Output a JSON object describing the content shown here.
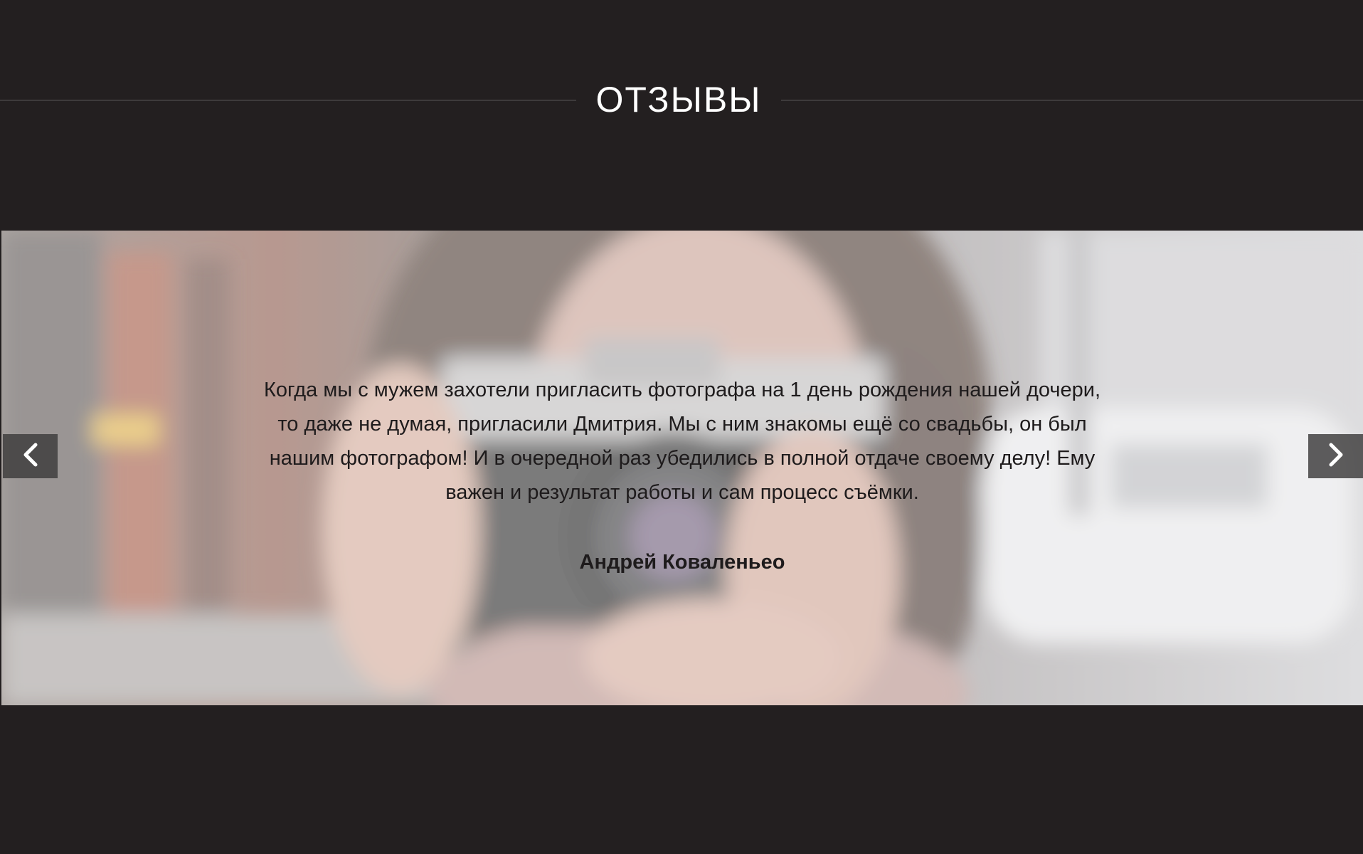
{
  "section": {
    "title": "ОТЗЫВЫ"
  },
  "slider": {
    "review_text": "Когда мы с мужем захотели пригласить фотографа на 1 день рождения нашей дочери, то даже не думая, пригласили Дмитрия. Мы с ним знакомы ещё со свадьбы, он был нашим фотографом! И в очередной раз убедились в полной отдаче своему делу! Ему важен и результат работы и сам процесс съёмки.",
    "author": "Андрей Коваленьео",
    "prev_icon": "chevron-left-icon",
    "next_icon": "chevron-right-icon",
    "background_image": "woman-with-camera-photo"
  },
  "colors": {
    "page_background": "#231f20",
    "title_text": "#ffffff",
    "review_text": "#1e1b1c",
    "nav_button": "#3c3a3a"
  }
}
